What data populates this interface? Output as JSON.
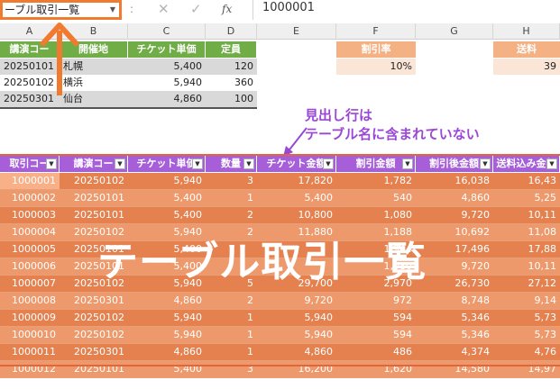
{
  "formula_bar": {
    "name_box": "ーブル取引一覧",
    "name_box_dropdown_icon": "triangle-down",
    "separator": ":",
    "cancel_icon": "✕",
    "enter_icon": "✓",
    "fx_label": "fx",
    "value": "1000001"
  },
  "columns": [
    "A",
    "B",
    "C",
    "D",
    "E",
    "F",
    "G",
    "H"
  ],
  "top_table": {
    "headers": [
      "講演コー",
      "開催地",
      "チケット単価",
      "定員"
    ],
    "rows": [
      {
        "code": "20250101",
        "city": "札幌",
        "price": "5,400",
        "cap": "120"
      },
      {
        "code": "20250102",
        "city": "横浜",
        "price": "5,940",
        "cap": "360"
      },
      {
        "code": "20250301",
        "city": "仙台",
        "price": "4,860",
        "cap": "100"
      }
    ]
  },
  "discount": {
    "header": "割引率",
    "value": "10%"
  },
  "shipping": {
    "header": "送料",
    "value": "39"
  },
  "annotation": {
    "line1": "見出し行は",
    "line2": "テーブル名に含まれていない"
  },
  "main_table": {
    "headers": [
      "取引コー",
      "講演コー",
      "チケット単価",
      "数量",
      "チケット金額",
      "割引金額",
      "割引後金額",
      "送料込み金額"
    ],
    "rows": [
      [
        "1000001",
        "20250102",
        "5,940",
        "3",
        "17,820",
        "1,782",
        "16,038",
        "16,43"
      ],
      [
        "1000002",
        "20250101",
        "5,400",
        "1",
        "5,400",
        "540",
        "4,860",
        "5,25"
      ],
      [
        "1000003",
        "20250101",
        "5,400",
        "2",
        "10,800",
        "1,080",
        "9,720",
        "10,11"
      ],
      [
        "1000004",
        "20250102",
        "5,940",
        "2",
        "11,880",
        "1,188",
        "10,692",
        "11,08"
      ],
      [
        "1000005",
        "20250101",
        "5,400",
        "",
        "",
        "1,944",
        "17,496",
        "17,88"
      ],
      [
        "1000006",
        "20250101",
        "5,400",
        "",
        "",
        "1,080",
        "9,720",
        "10,11"
      ],
      [
        "1000007",
        "20250102",
        "5,940",
        "5",
        "29,700",
        "2,970",
        "26,730",
        "27,12"
      ],
      [
        "1000008",
        "20250301",
        "4,860",
        "2",
        "9,720",
        "972",
        "8,748",
        "9,14"
      ],
      [
        "1000009",
        "20250102",
        "5,940",
        "1",
        "5,940",
        "594",
        "5,346",
        "5,73"
      ],
      [
        "1000010",
        "20250102",
        "5,940",
        "1",
        "5,940",
        "594",
        "5,346",
        "5,73"
      ],
      [
        "1000011",
        "20250301",
        "4,860",
        "1",
        "4,860",
        "486",
        "4,374",
        "4,76"
      ],
      [
        "1000012",
        "20250101",
        "5,400",
        "3",
        "16,200",
        "1,620",
        "14,580",
        "14,97"
      ]
    ]
  },
  "overlay_title": "テーブル取引一覧",
  "colors": {
    "accent_orange": "#f07a30",
    "purple": "#a65fd8",
    "green": "#70ad47"
  }
}
